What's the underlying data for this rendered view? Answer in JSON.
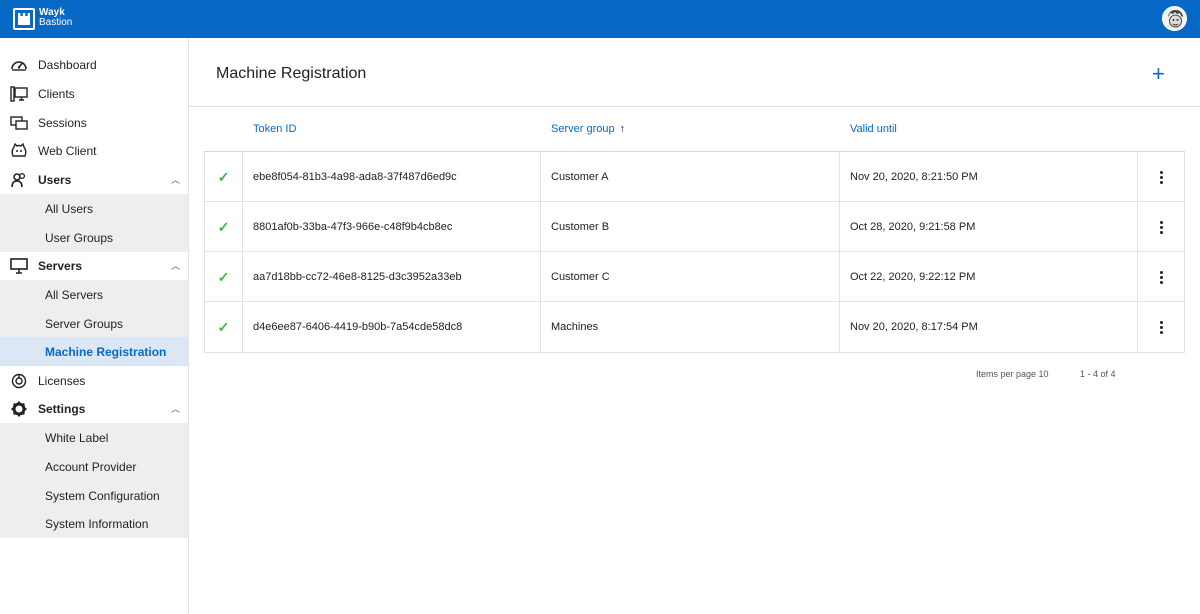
{
  "app": {
    "logo_line1": "Wayk",
    "logo_line2": "Bastion"
  },
  "sidebar": {
    "items": [
      {
        "label": "Dashboard"
      },
      {
        "label": "Clients"
      },
      {
        "label": "Sessions"
      },
      {
        "label": "Web Client"
      },
      {
        "label": "Users"
      },
      {
        "label": "All Users"
      },
      {
        "label": "User Groups"
      },
      {
        "label": "Servers"
      },
      {
        "label": "All Servers"
      },
      {
        "label": "Server Groups"
      },
      {
        "label": "Machine Registration"
      },
      {
        "label": "Licenses"
      },
      {
        "label": "Settings"
      },
      {
        "label": "White Label"
      },
      {
        "label": "Account Provider"
      },
      {
        "label": "System Configuration"
      },
      {
        "label": "System Information"
      }
    ]
  },
  "main": {
    "title": "Machine Registration",
    "add_label": "+",
    "columns": {
      "token": "Token ID",
      "group": "Server group",
      "valid": "Valid until",
      "sort_arrow": "↑"
    },
    "rows": [
      {
        "token": "ebe8f054-81b3-4a98-ada8-37f487d6ed9c",
        "group": "Customer A",
        "valid": "Nov 20, 2020, 8:21:50 PM"
      },
      {
        "token": "8801af0b-33ba-47f3-966e-c48f9b4cb8ec",
        "group": "Customer B",
        "valid": "Oct 28, 2020, 9:21:58 PM"
      },
      {
        "token": "aa7d18bb-cc72-46e8-8125-d3c3952a33eb",
        "group": "Customer C",
        "valid": "Oct 22, 2020, 9:22:12 PM"
      },
      {
        "token": "d4e6ee87-6406-4419-b90b-7a54cde58dc8",
        "group": "Machines",
        "valid": "Nov 20, 2020, 8:17:54 PM"
      }
    ],
    "pager": {
      "items_per_page": "Items per page 10",
      "range": "1 - 4 of 4"
    }
  },
  "colors": {
    "brand": "#0868c6",
    "check": "#3fb54a",
    "active_bg": "#dbe7f5"
  }
}
